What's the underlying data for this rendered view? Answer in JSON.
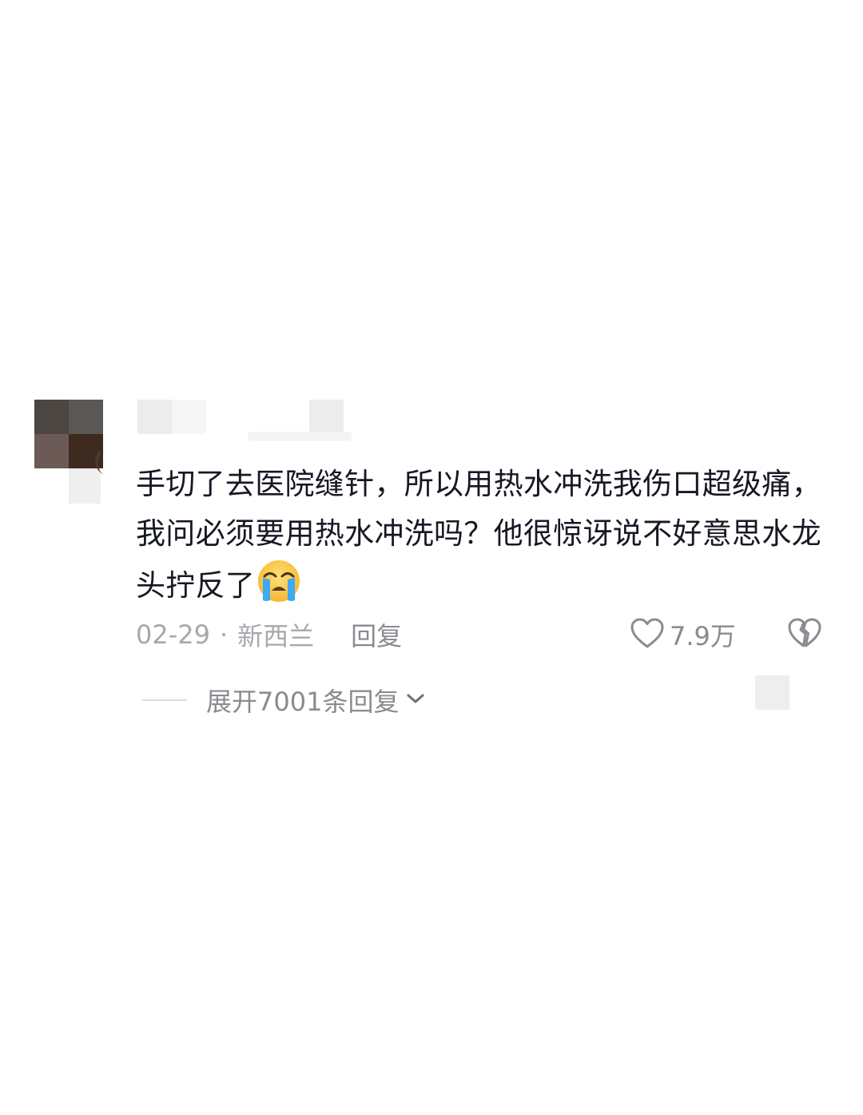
{
  "comment": {
    "text": "手切了去医院缝针，所以用热水冲洗我伤口超级痛，我问必须要用热水冲洗吗？他很惊讶说不好意思水龙头拧反了",
    "emoji": "loudly-crying-face",
    "date": "02-29",
    "separator": "·",
    "location": "新西兰",
    "reply_label": "回复",
    "like_count": "7.9万",
    "expand_label": "展开7001条回复"
  },
  "icons": {
    "like": "heart-outline-icon",
    "dislike": "broken-heart-icon",
    "expand": "chevron-down-icon"
  },
  "colors": {
    "text_primary": "#161823",
    "text_secondary": "#8a8b90",
    "text_meta": "#a7a8ad",
    "background": "#ffffff"
  }
}
